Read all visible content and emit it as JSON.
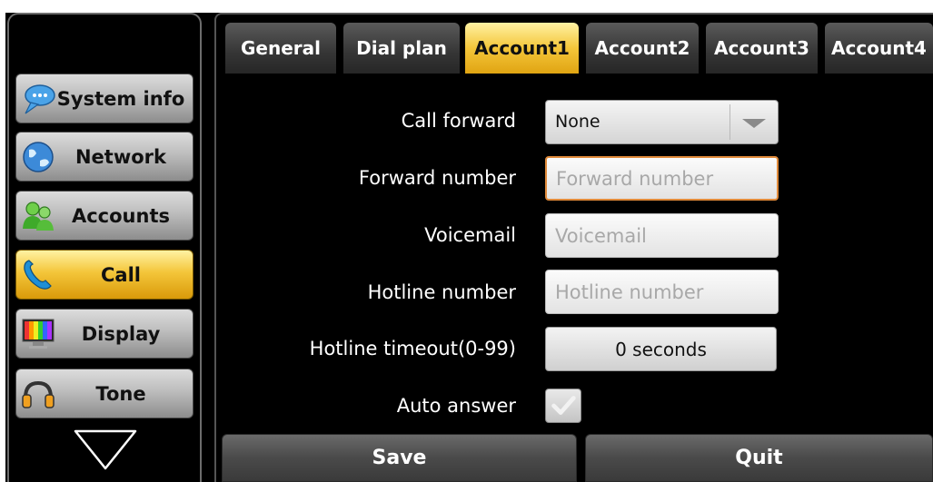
{
  "sidebar": {
    "items": [
      {
        "label": "System info",
        "icon": "chat-bubble-icon",
        "active": false
      },
      {
        "label": "Network",
        "icon": "globe-icon",
        "active": false
      },
      {
        "label": "Accounts",
        "icon": "users-icon",
        "active": false
      },
      {
        "label": "Call",
        "icon": "phone-handset-icon",
        "active": true
      },
      {
        "label": "Display",
        "icon": "monitor-icon",
        "active": false
      },
      {
        "label": "Tone",
        "icon": "headphones-icon",
        "active": false
      }
    ],
    "scroll_icon": "triangle-down-icon"
  },
  "tabs": [
    {
      "label": "General",
      "active": false
    },
    {
      "label": "Dial plan",
      "active": false
    },
    {
      "label": "Account1",
      "active": true
    },
    {
      "label": "Account2",
      "active": false
    },
    {
      "label": "Account3",
      "active": false
    },
    {
      "label": "Account4",
      "active": false
    }
  ],
  "form": {
    "call_forward": {
      "label": "Call forward",
      "value": "None"
    },
    "forward_number": {
      "label": "Forward number",
      "placeholder": "Forward number",
      "value": ""
    },
    "voicemail": {
      "label": "Voicemail",
      "placeholder": "Voicemail",
      "value": ""
    },
    "hotline_number": {
      "label": "Hotline number",
      "placeholder": "Hotline number",
      "value": ""
    },
    "hotline_timeout": {
      "label": "Hotline timeout(0-99)",
      "value": "0 seconds"
    },
    "auto_answer": {
      "label": "Auto answer",
      "checked": true
    }
  },
  "actions": {
    "save_label": "Save",
    "quit_label": "Quit"
  },
  "colors": {
    "accent_yellow": "#f4c63a",
    "focus_orange": "#e08a3a",
    "background": "#000000"
  }
}
